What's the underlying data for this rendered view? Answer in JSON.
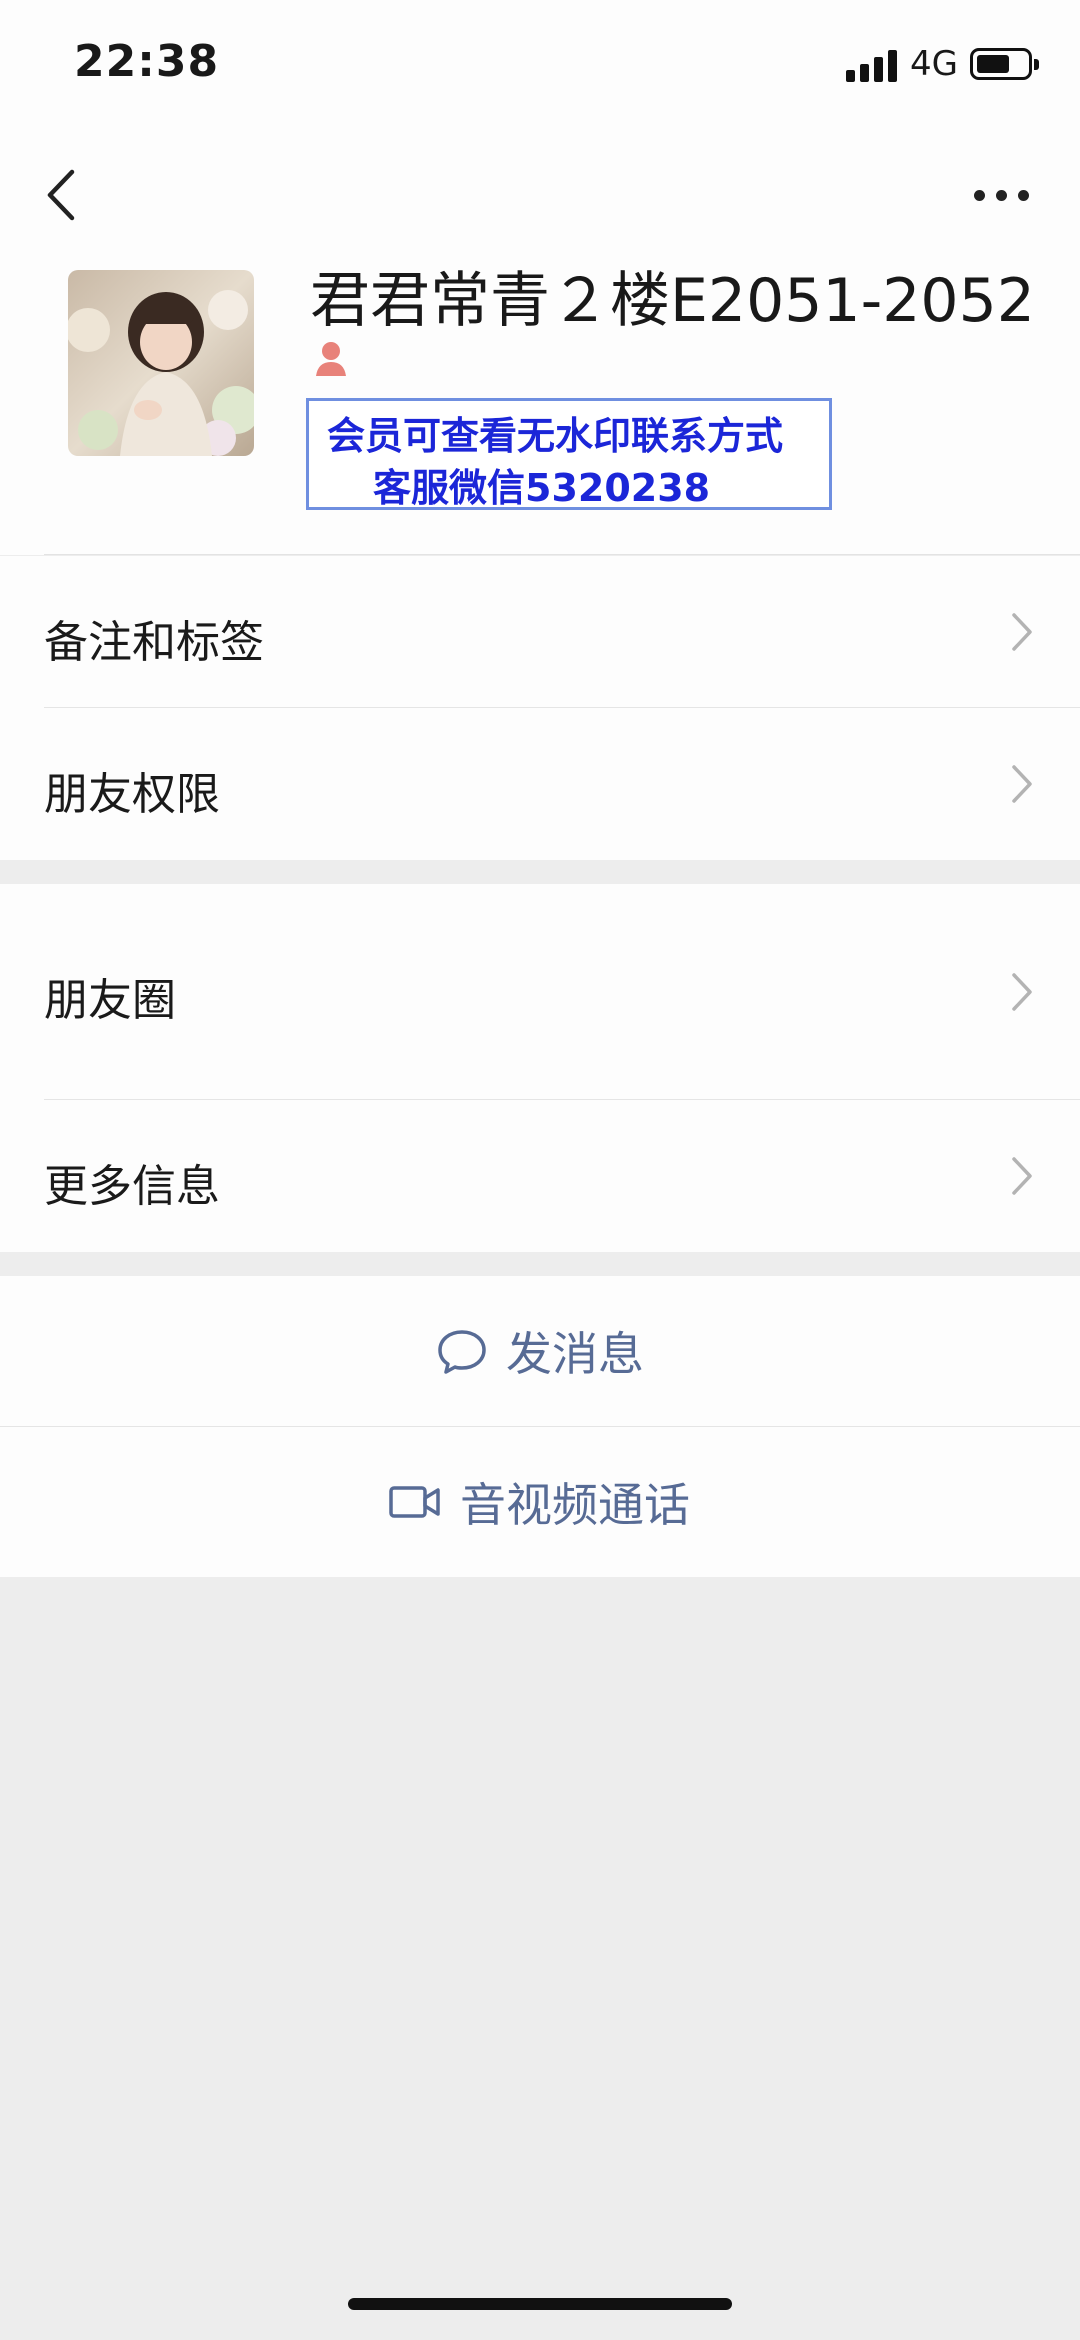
{
  "status_bar": {
    "time": "22:38",
    "network": "4G"
  },
  "profile": {
    "name": "君君常青２楼E2051-2052",
    "watermark": {
      "line1": "会员可查看无水印联系方式",
      "line2": "客服微信5320238"
    }
  },
  "menu": {
    "remarks_tags": "备注和标签",
    "friend_permissions": "朋友权限",
    "moments": "朋友圈",
    "more_info": "更多信息"
  },
  "actions": {
    "send_message": "发消息",
    "video_call": "音视频通话"
  },
  "colors": {
    "link": "#576b95",
    "watermark_text": "#1b26d8",
    "background": "#ededed"
  }
}
